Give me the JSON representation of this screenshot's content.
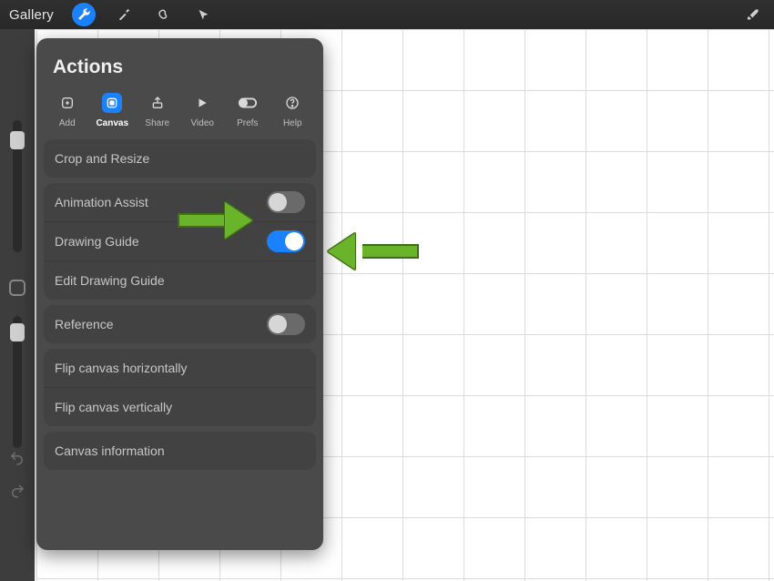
{
  "topbar": {
    "gallery": "Gallery"
  },
  "panel": {
    "title": "Actions",
    "tabs": {
      "add": "Add",
      "canvas": "Canvas",
      "share": "Share",
      "video": "Video",
      "prefs": "Prefs",
      "help": "Help"
    },
    "rows": {
      "crop_resize": "Crop and Resize",
      "animation_assist": "Animation Assist",
      "drawing_guide": "Drawing Guide",
      "edit_drawing_guide": "Edit Drawing Guide",
      "reference": "Reference",
      "flip_h": "Flip canvas horizontally",
      "flip_v": "Flip canvas vertically",
      "canvas_info": "Canvas information"
    },
    "toggles": {
      "animation_assist": "off",
      "drawing_guide": "on",
      "reference": "off"
    }
  }
}
